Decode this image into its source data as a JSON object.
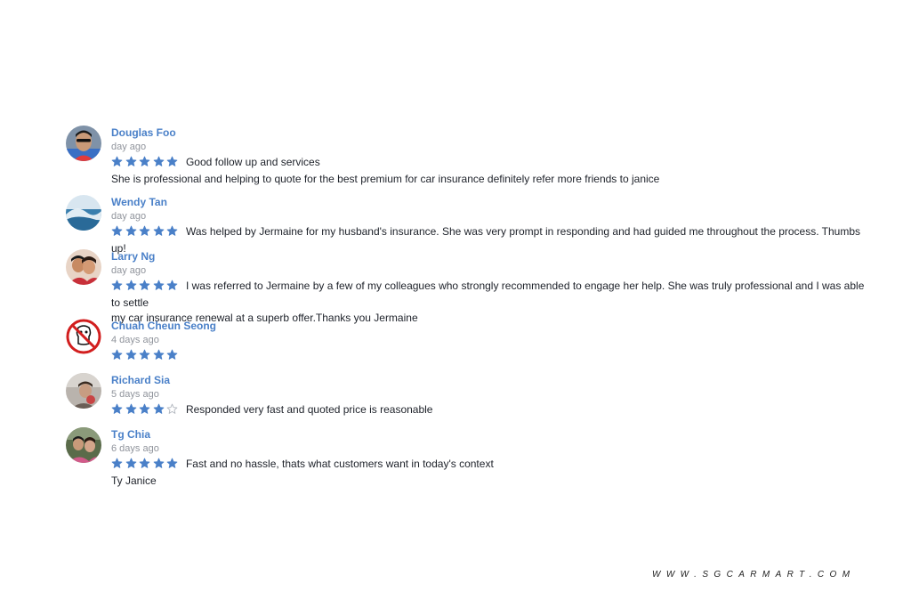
{
  "colors": {
    "name_link": "#4a80c8",
    "star_filled": "#4a80c8",
    "star_empty": "#b0b5bd",
    "timestamp": "#90949c"
  },
  "reviews": [
    {
      "name": "Douglas Foo",
      "time": "day ago",
      "rating": 5,
      "text": "Good follow up and services",
      "continuation": "She is professional and helping to quote for the best premium for car insurance definitely refer more friends to janice"
    },
    {
      "name": "Wendy Tan",
      "time": "day ago",
      "rating": 5,
      "text": "Was helped by Jermaine for my husband's insurance.  She was very prompt in responding and had guided me throughout the process.  Thumbs up!"
    },
    {
      "name": "Larry Ng",
      "time": "day ago",
      "rating": 5,
      "text": "I was referred to Jermaine by a few of my colleagues who strongly recommended to engage her help. She was truly professional and I was able to settle",
      "continuation": "my car insurance renewal at a superb offer.Thanks you Jermaine"
    },
    {
      "name": "Chuah Cheun Seong",
      "time": "4 days ago",
      "rating": 5,
      "text": ""
    },
    {
      "name": "Richard Sia",
      "time": "5 days ago",
      "rating": 4,
      "text": "Responded very fast and quoted price is reasonable"
    },
    {
      "name": "Tg Chia",
      "time": "6 days ago",
      "rating": 5,
      "text": "Fast and no hassle, thats what customers want in today's context",
      "continuation": "Ty Janice"
    }
  ],
  "watermark": "WWW.SGCARMART.COM"
}
